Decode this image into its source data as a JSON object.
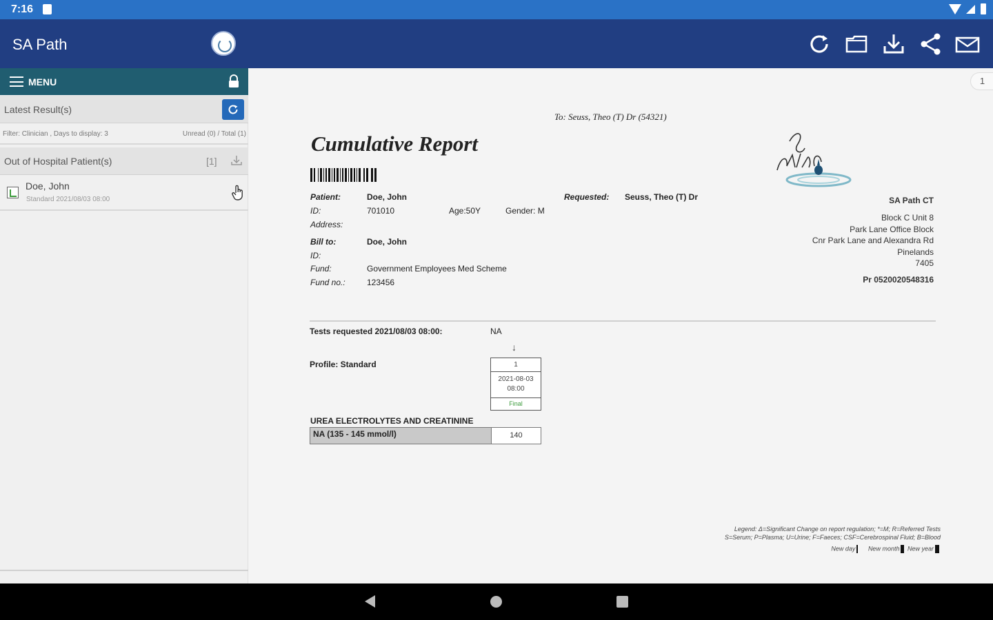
{
  "status_bar": {
    "time": "7:16"
  },
  "app_bar": {
    "title": "SA Path",
    "icons": [
      "refresh-icon",
      "folder-icon",
      "download-icon",
      "share-icon",
      "mail-icon"
    ]
  },
  "sidebar": {
    "menu_label": "MENU",
    "latest_results": "Latest Result(s)",
    "filter_text": "Filter: Clinician , Days to display: 3",
    "counts_text": "Unread (0) / Total (1)",
    "out_of_hospital": "Out of Hospital Patient(s)",
    "out_of_hospital_count": "[1]",
    "patient": {
      "name": "Doe, John",
      "detail": "Standard 2021/08/03 08:00"
    }
  },
  "report": {
    "page_number": "1",
    "to_line": "To: Seuss, Theo (T) Dr (54321)",
    "title": "Cumulative Report",
    "patient_label": "Patient:",
    "patient_value": "Doe, John",
    "requested_label": "Requested:",
    "requested_value": "Seuss, Theo (T) Dr",
    "id_label": "ID:",
    "id_value": "701010",
    "age": "Age:50Y",
    "gender": "Gender: M",
    "address_label": "Address:",
    "bill_to_label": "Bill to:",
    "bill_to_value": "Doe, John",
    "bill_id_label": "ID:",
    "fund_label": "Fund:",
    "fund_value": "Government Employees Med Scheme",
    "fund_no_label": "Fund no.:",
    "fund_no_value": "123456",
    "lab": {
      "name": "SA Path CT",
      "address_lines": [
        "Block C Unit 8",
        "Park Lane Office Block",
        "Cnr Park Lane and Alexandra Rd",
        "Pinelands",
        "7405"
      ],
      "practice_no": "Pr 0520020548316"
    },
    "tests_requested": "Tests requested 2021/08/03 08:00:",
    "tests_requested_value": "NA",
    "arrow": "↓",
    "profile": "Profile: Standard",
    "column": {
      "number": "1",
      "date": "2021-08-03",
      "time": "08:00",
      "status": "Final"
    },
    "section": "UREA ELECTROLYTES AND CREATININE",
    "result": {
      "test": "NA (135 - 145 mmol/l)",
      "value": "140"
    },
    "legend": {
      "line1": "Legend: Δ=Significant Change on report regulation; *=M; R=Referred Tests",
      "line2": "S=Serum; P=Plasma; U=Urine; F=Faeces; CSF=Cerebrospinal Fluid; B=Blood",
      "new_day": "New day",
      "new_month": "New month",
      "new_year": "New year"
    }
  },
  "colors": {
    "status_bar": "#2a72c6",
    "app_bar": "#213e82",
    "menu_bar": "#205d70",
    "refresh_button": "#2469b9",
    "final_status": "#3a9a3a"
  }
}
